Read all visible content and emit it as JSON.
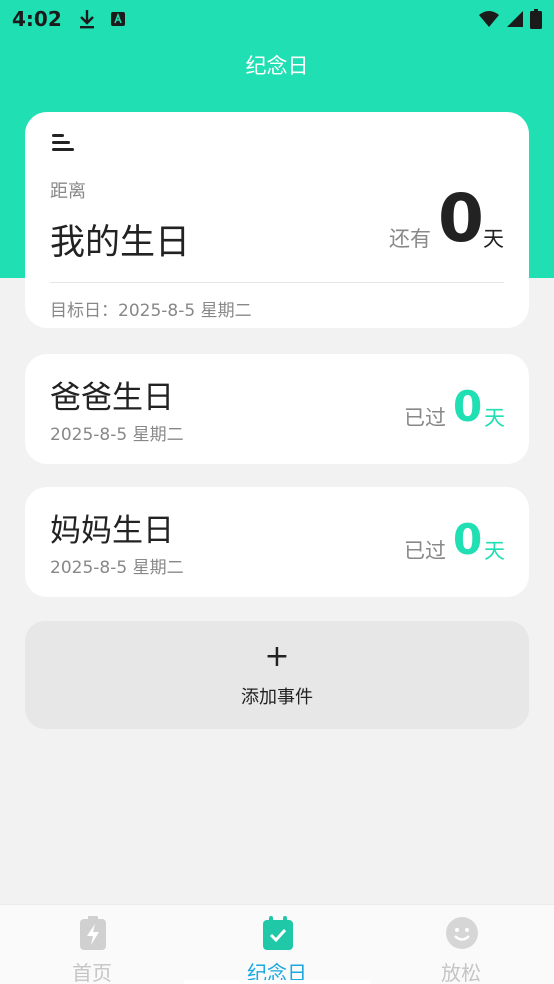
{
  "status_bar": {
    "time": "4:02",
    "icons": [
      "download-icon",
      "font-app-icon",
      "wifi-icon",
      "signal-icon",
      "battery-icon"
    ]
  },
  "header": {
    "title": "纪念日"
  },
  "main_event": {
    "distance_label": "距离",
    "name": "我的生日",
    "remain_label": "还有",
    "days": "0",
    "unit": "天",
    "target_date": "目标日：2025-8-5 星期二"
  },
  "events": [
    {
      "name": "爸爸生日",
      "date": "2025-8-5 星期二",
      "passed_label": "已过",
      "days": "0",
      "unit": "天"
    },
    {
      "name": "妈妈生日",
      "date": "2025-8-5 星期二",
      "passed_label": "已过",
      "days": "0",
      "unit": "天"
    }
  ],
  "add_event": {
    "plus": "+",
    "label": "添加事件"
  },
  "bottom_nav": {
    "items": [
      {
        "label": "首页",
        "icon": "battery-bolt-icon",
        "active": false
      },
      {
        "label": "纪念日",
        "icon": "calendar-check-icon",
        "active": true
      },
      {
        "label": "放松",
        "icon": "smiley-icon",
        "active": false
      }
    ]
  },
  "colors": {
    "accent": "#1fdfb3",
    "active_nav": "#1aa8e0",
    "background": "#f2f2f2",
    "inactive_nav": "#c5c5c5"
  }
}
